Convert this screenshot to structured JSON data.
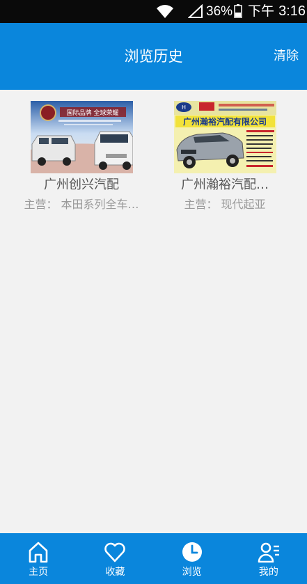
{
  "status_bar": {
    "battery_text": "36%",
    "time_period": "下午",
    "time": "3:16"
  },
  "header": {
    "title": "浏览历史",
    "clear_label": "清除"
  },
  "history": [
    {
      "name": "广州创兴汽配",
      "main_business": "主营： 本田系列全车…",
      "thumbnail": {
        "banner_text": "国际品牌 全球荣耀",
        "colors": {
          "sky": "#c9dcf2",
          "banner": "#8a1f24",
          "van": "#e8e8e8"
        }
      }
    },
    {
      "name": "广州瀚裕汽配…",
      "main_business": "主营： 现代起亚",
      "thumbnail": {
        "headline": "广州瀚裕汽配有限公司",
        "colors": {
          "bg": "#f4f0b0",
          "headline_bg": "#f2e23a",
          "headline_text": "#1a3a8a",
          "car": "#9aa2ab"
        }
      }
    }
  ],
  "nav": [
    {
      "label": "主页",
      "icon": "home-icon"
    },
    {
      "label": "收藏",
      "icon": "heart-icon"
    },
    {
      "label": "浏览",
      "icon": "clock-icon"
    },
    {
      "label": "我的",
      "icon": "user-list-icon"
    }
  ],
  "colors": {
    "primary": "#0a86dc",
    "background": "#f2f2f2",
    "status_bar": "#0a0a0a"
  }
}
